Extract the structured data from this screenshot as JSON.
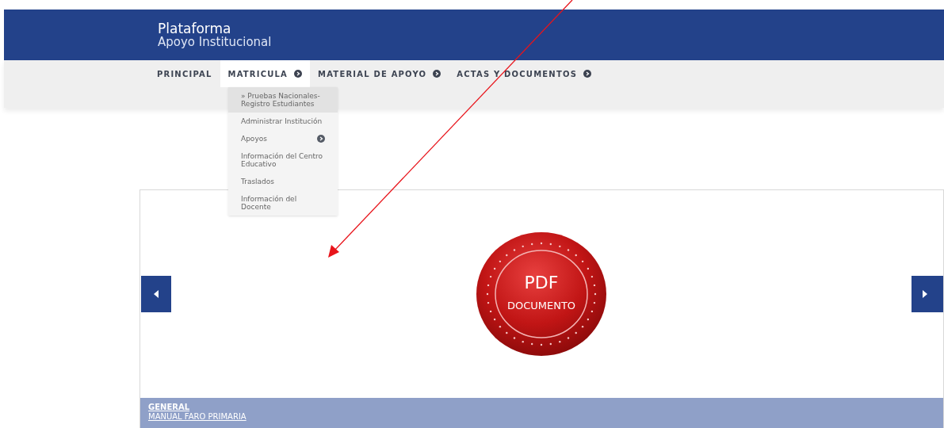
{
  "header": {
    "title": "Plataforma",
    "subtitle": "Apoyo Institucional"
  },
  "nav": [
    {
      "label": "PRINCIPAL",
      "has_submenu": false,
      "selected": false
    },
    {
      "label": "MATRICULA",
      "has_submenu": true,
      "selected": true
    },
    {
      "label": "MATERIAL DE APOYO",
      "has_submenu": true,
      "selected": false
    },
    {
      "label": "ACTAS Y DOCUMENTOS",
      "has_submenu": true,
      "selected": false
    }
  ],
  "dropdown": [
    {
      "label": "» Pruebas Nacionales-Registro Estudiantes",
      "selected": true,
      "has_submenu": false
    },
    {
      "label": "Administrar Institución",
      "selected": false,
      "has_submenu": false
    },
    {
      "label": "Apoyos",
      "selected": false,
      "has_submenu": true
    },
    {
      "label": "Información del Centro Educativo",
      "selected": false,
      "has_submenu": false
    },
    {
      "label": "Traslados",
      "selected": false,
      "has_submenu": false
    },
    {
      "label": "Información del Docente",
      "selected": false,
      "has_submenu": false
    }
  ],
  "carousel": {
    "seal": {
      "line_1": "PDF",
      "line_2": "DOCUMENTO"
    },
    "caption": {
      "category": "GENERAL",
      "link": "MANUAL FARO PRIMARIA"
    }
  }
}
